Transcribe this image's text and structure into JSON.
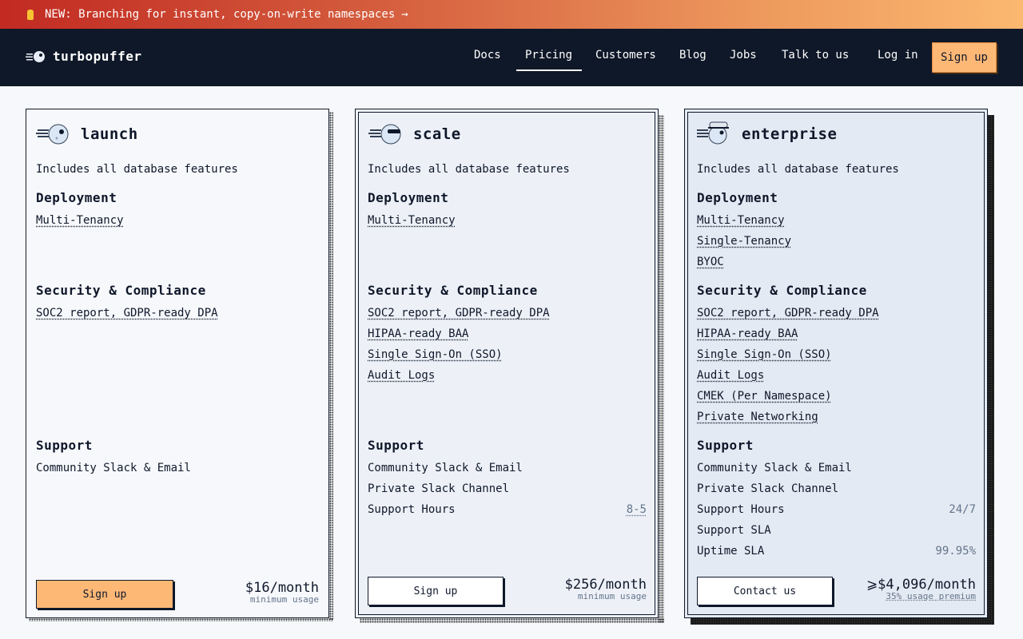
{
  "banner": {
    "text": "NEW: Branching for instant, copy-on-write namespaces",
    "arrow": "→",
    "icon": "bulb-icon"
  },
  "nav": {
    "brand": "turbopuffer",
    "links": [
      "Docs",
      "Pricing",
      "Customers",
      "Blog",
      "Jobs",
      "Talk to us"
    ],
    "active": "Pricing",
    "login": "Log in",
    "signup": "Sign up"
  },
  "colors": {
    "accent": "#fdb876",
    "nav_bg": "#0f1828",
    "text": "#0f172a"
  },
  "plans": [
    {
      "tier": "launch",
      "desc": "Includes all database features",
      "deployment_title": "Deployment",
      "deployment": [
        "Multi-Tenancy"
      ],
      "security_title": "Security & Compliance",
      "security": [
        "SOC2 report, GDPR-ready DPA"
      ],
      "support_title": "Support",
      "support": [
        {
          "label": "Community Slack & Email",
          "value": ""
        }
      ],
      "button": "Sign up",
      "price": "$16/month",
      "price_note": "minimum usage"
    },
    {
      "tier": "scale",
      "desc": "Includes all database features",
      "deployment_title": "Deployment",
      "deployment": [
        "Multi-Tenancy"
      ],
      "security_title": "Security & Compliance",
      "security": [
        "SOC2 report, GDPR-ready DPA",
        "HIPAA-ready BAA",
        "Single Sign-On (SSO)",
        "Audit Logs"
      ],
      "support_title": "Support",
      "support": [
        {
          "label": "Community Slack & Email",
          "value": ""
        },
        {
          "label": "Private Slack Channel",
          "value": ""
        },
        {
          "label": "Support Hours",
          "value": "8-5"
        }
      ],
      "button": "Sign up",
      "price": "$256/month",
      "price_note": "minimum usage"
    },
    {
      "tier": "enterprise",
      "desc": "Includes all database features",
      "deployment_title": "Deployment",
      "deployment": [
        "Multi-Tenancy",
        "Single-Tenancy",
        "BYOC"
      ],
      "security_title": "Security & Compliance",
      "security": [
        "SOC2 report, GDPR-ready DPA",
        "HIPAA-ready BAA",
        "Single Sign-On (SSO)",
        "Audit Logs",
        "CMEK (Per Namespace)",
        "Private Networking"
      ],
      "support_title": "Support",
      "support": [
        {
          "label": "Community Slack & Email",
          "value": ""
        },
        {
          "label": "Private Slack Channel",
          "value": ""
        },
        {
          "label": "Support Hours",
          "value": "24/7"
        },
        {
          "label": "Support SLA",
          "value": ""
        },
        {
          "label": "Uptime SLA",
          "value": "99.95%"
        }
      ],
      "button": "Contact us",
      "price": "⩾$4,096/month",
      "price_note": "35% usage premium"
    }
  ]
}
